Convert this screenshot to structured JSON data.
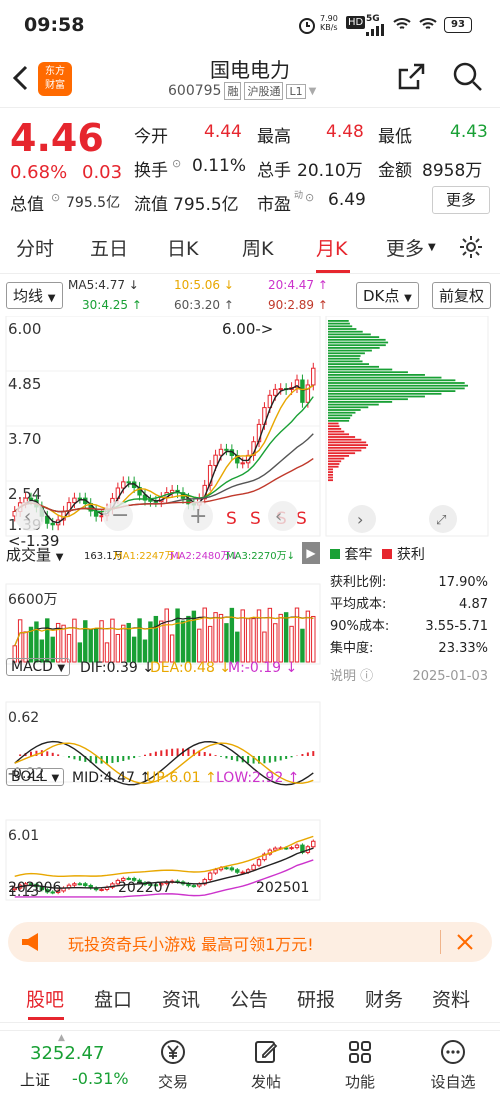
{
  "status_bar": {
    "time": "09:58",
    "net_speed": "7.90\nKB/s",
    "network": "5G",
    "battery": "93"
  },
  "header": {
    "title": "国电电力",
    "code": "600795",
    "badge_rong": "融",
    "badge_hgt": "沪股通",
    "badge_level": "L1",
    "logo_line1": "东方",
    "logo_line2": "财富"
  },
  "quote": {
    "price": "4.46",
    "pct": "0.68%",
    "change": "0.03",
    "open_label": "今开",
    "open": "4.44",
    "high_label": "最高",
    "high": "4.48",
    "low_label": "最低",
    "low": "4.43",
    "turnover_label": "换手",
    "turnover": "0.11%",
    "volume_label": "总手",
    "volume": "20.10万",
    "amount_label": "金额",
    "amount": "8958万",
    "mktcap_label": "总值",
    "mktcap": "795.5亿",
    "float_label": "流值",
    "float": "795.5亿",
    "pe_label": "市盈",
    "pe": "6.49",
    "more": "更多"
  },
  "tabs": [
    {
      "label": "分时",
      "active": false
    },
    {
      "label": "五日",
      "active": false
    },
    {
      "label": "日K",
      "active": false
    },
    {
      "label": "周K",
      "active": false
    },
    {
      "label": "月K",
      "active": true
    },
    {
      "label": "更多",
      "active": false
    }
  ],
  "ma": {
    "selector": "均线",
    "ma5": "MA5:4.77 ↓",
    "ma10": "10:5.06 ↓",
    "ma20": "20:4.47 ↑",
    "ma30": "30:4.25 ↑",
    "ma60": "60:3.20 ↑",
    "ma90": "90:2.89 ↑",
    "dk_button": "DK点",
    "fq_button": "前复权"
  },
  "price_axis": {
    "p1": "6.00",
    "p2": "4.85",
    "p3": "3.70",
    "p4": "2.54",
    "p5": "1.39",
    "p5b": "1.39",
    "high_mark": "6.00->",
    "low_mark": "<-1.39"
  },
  "volume": {
    "selector": "成交量",
    "vol": "163.1万",
    "ma1": "MA1:2247万↓",
    "ma2": "MA2:2480万↓",
    "ma3": "MA3:2270万↓",
    "axis_max": "6600万"
  },
  "macd": {
    "selector": "MACD",
    "dif": "DIF:0.39 ↓",
    "dea": "DEA:0.48 ↓",
    "m": "M:-0.19 ↓",
    "axis_top": "0.62",
    "axis_bottom": "-0.22"
  },
  "boll": {
    "selector": "BOLL",
    "mid": "MID:4.47 ↑",
    "up": "UP:6.01 ↑",
    "low": "LOW:2.92 ↑",
    "axis_top": "6.01",
    "axis_bottom": "1.13"
  },
  "dates": {
    "d1": "202006",
    "d2": "202207",
    "d3": "202501"
  },
  "chip": {
    "legend_trapped": "套牢",
    "legend_profit": "获利",
    "profit_ratio_label": "获利比例:",
    "profit_ratio": "17.90%",
    "avg_cost_label": "平均成本:",
    "avg_cost": "4.87",
    "cost90_label": "90%成本:",
    "cost90": "3.55-5.71",
    "concentration_label": "集中度:",
    "concentration": "23.33%",
    "note_label": "说明",
    "date": "2025-01-03"
  },
  "banner": {
    "text": "玩投资奇兵小游戏 最高可领1万元!"
  },
  "subtabs": [
    {
      "label": "股吧",
      "active": true
    },
    {
      "label": "盘口",
      "active": false
    },
    {
      "label": "资讯",
      "active": false
    },
    {
      "label": "公告",
      "active": false
    },
    {
      "label": "研报",
      "active": false
    },
    {
      "label": "财务",
      "active": false
    },
    {
      "label": "资料",
      "active": false
    }
  ],
  "bottom_nav": {
    "index_value": "3252.47",
    "index_name": "上证",
    "index_pct": "-0.31%",
    "items": [
      {
        "label": "交易",
        "icon": "yen-icon"
      },
      {
        "label": "发帖",
        "icon": "edit-icon"
      },
      {
        "label": "功能",
        "icon": "grid-icon"
      },
      {
        "label": "设自选",
        "icon": "more-icon"
      }
    ]
  },
  "colors": {
    "up": "#e6262e",
    "down": "#19a035",
    "accent": "#ff6a00"
  }
}
